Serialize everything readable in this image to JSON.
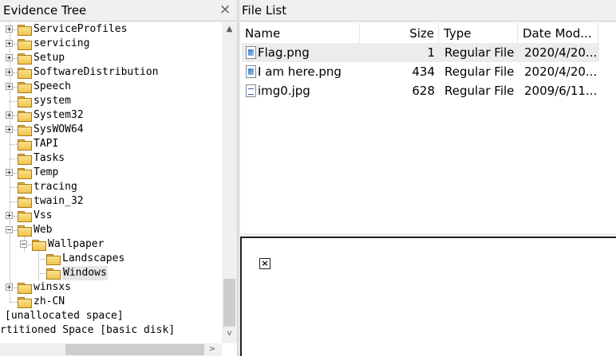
{
  "evidence_tree": {
    "title": "Evidence Tree",
    "close_icon": "×",
    "nodes": [
      {
        "label": "ServiceProfiles",
        "expander": "plus"
      },
      {
        "label": "servicing",
        "expander": "plus"
      },
      {
        "label": "Setup",
        "expander": "plus"
      },
      {
        "label": "SoftwareDistribution",
        "expander": "plus"
      },
      {
        "label": "Speech",
        "expander": "plus"
      },
      {
        "label": "system",
        "expander": "none"
      },
      {
        "label": "System32",
        "expander": "plus"
      },
      {
        "label": "SysWOW64",
        "expander": "plus"
      },
      {
        "label": "TAPI",
        "expander": "none"
      },
      {
        "label": "Tasks",
        "expander": "none"
      },
      {
        "label": "Temp",
        "expander": "plus"
      },
      {
        "label": "tracing",
        "expander": "none"
      },
      {
        "label": "twain_32",
        "expander": "none"
      },
      {
        "label": "Vss",
        "expander": "plus"
      },
      {
        "label": "Web",
        "expander": "minus"
      },
      {
        "label": "Wallpaper",
        "expander": "minus"
      },
      {
        "label": "Landscapes",
        "expander": "none"
      },
      {
        "label": "Windows",
        "expander": "none",
        "selected": true
      },
      {
        "label": "winsxs",
        "expander": "plus"
      },
      {
        "label": "zh-CN",
        "expander": "none"
      },
      {
        "label": "[unallocated space]"
      },
      {
        "label": "rtitioned Space [basic disk]"
      }
    ]
  },
  "file_list": {
    "title": "File List",
    "columns": [
      "Name",
      "Size",
      "Type",
      "Date Mod..."
    ],
    "rows": [
      {
        "name": "Flag.png",
        "size": "1",
        "type": "Regular File",
        "date": "2020/4/20...",
        "icon": "image-file-icon",
        "selected": true
      },
      {
        "name": "I am here.png",
        "size": "434",
        "type": "Regular File",
        "date": "2020/4/20...",
        "icon": "image-file-icon"
      },
      {
        "name": "img0.jpg",
        "size": "628",
        "type": "Regular File",
        "date": "2009/6/11...",
        "icon": "document-file-icon"
      }
    ]
  },
  "preview": {
    "icon": "broken-image-icon",
    "glyph": "×"
  },
  "scrollbar_glyphs": {
    "up": "▲",
    "down": "v",
    "right": ">"
  }
}
